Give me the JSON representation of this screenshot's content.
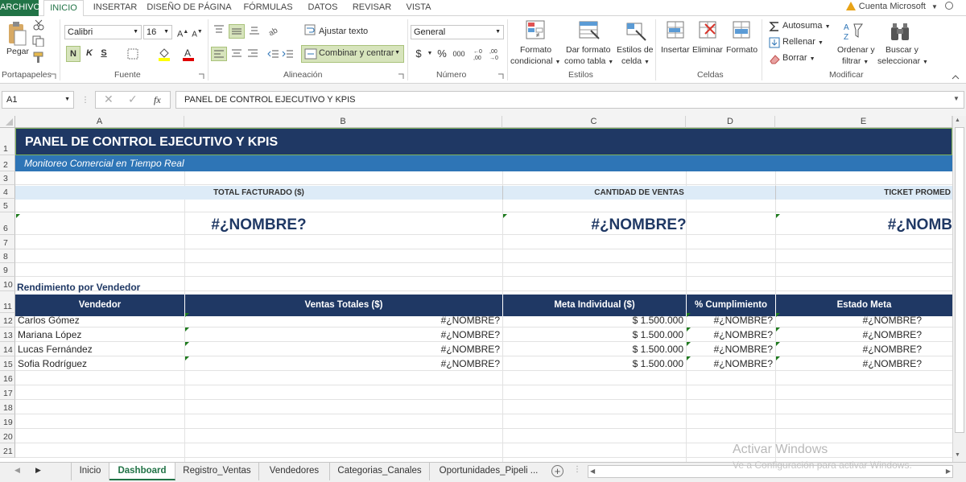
{
  "ribbon_tabs": [
    "ARCHIVO",
    "INICIO",
    "INSERTAR",
    "DISEÑO DE PÁGINA",
    "FÓRMULAS",
    "DATOS",
    "REVISAR",
    "VISTA"
  ],
  "account": "Cuenta Microsoft",
  "clipboard": {
    "paste": "Pegar",
    "group": "Portapapeles"
  },
  "font": {
    "name": "Calibri",
    "size": "16",
    "group": "Fuente",
    "bold": "N",
    "italic": "K",
    "underline": "S"
  },
  "alignment": {
    "wrap": "Ajustar texto",
    "merge": "Combinar y centrar",
    "group": "Alineación"
  },
  "number": {
    "format": "General",
    "currency": "$",
    "percent": "%",
    "thousands": "000",
    "group": "Número"
  },
  "styles": {
    "cond1": "Formato",
    "cond2": "condicional",
    "table1": "Dar formato",
    "table2": "como tabla",
    "cell1": "Estilos de",
    "cell2": "celda",
    "group": "Estilos"
  },
  "cells": {
    "insert": "Insertar",
    "delete": "Eliminar",
    "format": "Formato",
    "group": "Celdas"
  },
  "editing": {
    "autosum": "Autosuma",
    "fill": "Rellenar",
    "clear": "Borrar",
    "sort1": "Ordenar y",
    "sort2": "filtrar",
    "find1": "Buscar y",
    "find2": "seleccionar",
    "group": "Modificar"
  },
  "formula_bar": {
    "name_box": "A1",
    "fx": "fx",
    "formula": "PANEL DE CONTROL EJECUTIVO Y KPIS"
  },
  "columns": [
    "A",
    "B",
    "C",
    "D",
    "E"
  ],
  "rows": [
    "1",
    "2",
    "3",
    "4",
    "5",
    "6",
    "7",
    "8",
    "9",
    "10",
    "11",
    "12",
    "13",
    "14",
    "15",
    "16",
    "17",
    "18",
    "19",
    "20",
    "21"
  ],
  "sheet": {
    "title": "PANEL DE CONTROL EJECUTIVO Y KPIS",
    "subtitle": "Monitoreo Comercial en Tiempo Real",
    "kpi_labels": [
      "TOTAL FACTURADO ($)",
      "CANTIDAD DE VENTAS",
      "TICKET PROMED"
    ],
    "kpi_values": [
      "#¿NOMBRE?",
      "#¿NOMBRE?",
      "#¿NOMB"
    ],
    "section_title": "Rendimiento por Vendedor",
    "table_headers": [
      "Vendedor",
      "Ventas Totales ($)",
      "Meta Individual ($)",
      "% Cumplimiento",
      "Estado Meta"
    ],
    "table_rows": [
      [
        "Carlos Gómez",
        "#¿NOMBRE?",
        "$ 1.500.000",
        "#¿NOMBRE?",
        "#¿NOMBRE?"
      ],
      [
        "Mariana López",
        "#¿NOMBRE?",
        "$ 1.500.000",
        "#¿NOMBRE?",
        "#¿NOMBRE?"
      ],
      [
        "Lucas Fernández",
        "#¿NOMBRE?",
        "$ 1.500.000",
        "#¿NOMBRE?",
        "#¿NOMBRE?"
      ],
      [
        "Sofia Rodríguez",
        "#¿NOMBRE?",
        "$ 1.500.000",
        "#¿NOMBRE?",
        "#¿NOMBRE?"
      ]
    ]
  },
  "sheet_tabs": [
    "Inicio",
    "Dashboard",
    "Registro_Ventas",
    "Vendedores",
    "Categorias_Canales",
    "Oportunidades_Pipeli ..."
  ],
  "active_sheet": "Dashboard",
  "watermark": {
    "line1": "Activar Windows",
    "line2": "Ve a Configuración para activar Windows."
  },
  "colors": {
    "excel_green": "#217346",
    "title_navy": "#1f3864",
    "subtitle_blue": "#2e75b6",
    "kpi_light": "#ddebf7",
    "value_navy": "#1f3864"
  }
}
